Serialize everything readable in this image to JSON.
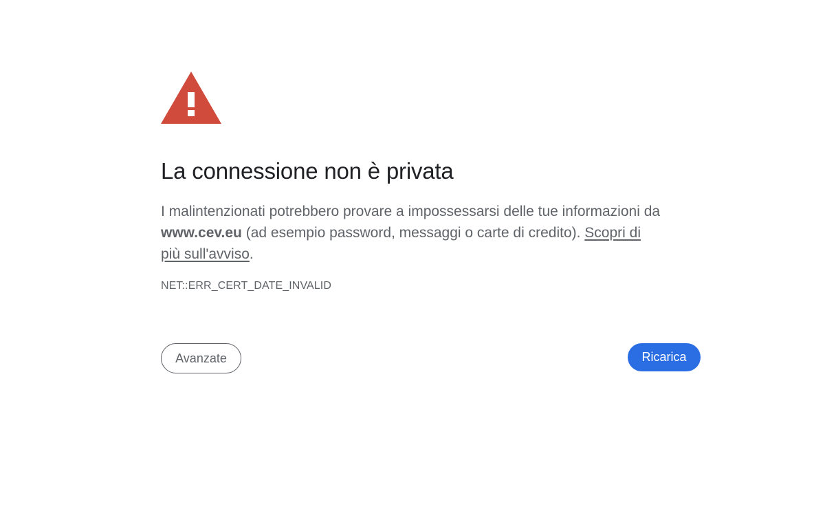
{
  "title": "La connessione non è privata",
  "message": {
    "text_before": "I malintenzionati potrebbero provare a impossessarsi delle tue informazioni da ",
    "domain": "www.cev.eu",
    "text_after": " (ad esempio password, messaggi o carte di credito). ",
    "link": "Scopri di più sull'avviso",
    "end": "."
  },
  "error_code": "NET::ERR_CERT_DATE_INVALID",
  "buttons": {
    "advanced": "Avanzate",
    "reload": "Ricarica"
  },
  "icon": {
    "name": "warning-triangle-icon",
    "color": "#d04b3c"
  },
  "colors": {
    "primary_button": "#2b6de3",
    "secondary_text": "#5f6368",
    "title_text": "#202124"
  }
}
